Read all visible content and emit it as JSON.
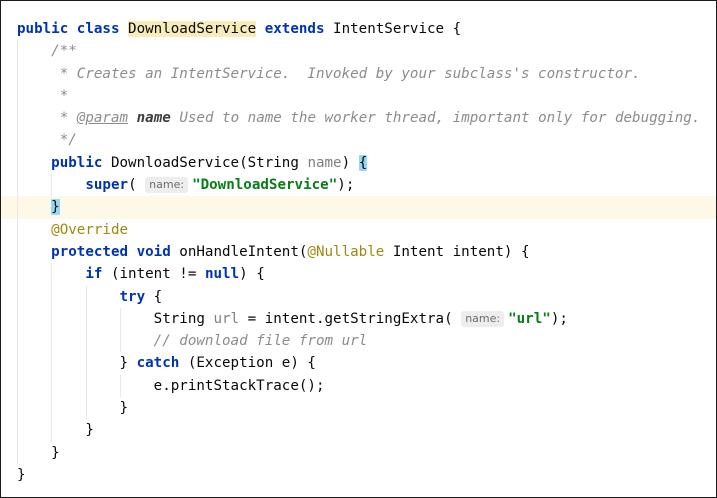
{
  "editor": {
    "lines": {
      "l1": {
        "kw1": "public class ",
        "cls": "DownloadService",
        "kw2": " extends ",
        "rest": "IntentService {"
      },
      "l2": {
        "indent": "    ",
        "text": "/**"
      },
      "l3": {
        "indent": "     ",
        "text": "* Creates an IntentService.  Invoked by your subclass's constructor."
      },
      "l4": {
        "indent": "     ",
        "text": "*"
      },
      "l5": {
        "indent": "     ",
        "star": "* ",
        "tag": "@param",
        "sp": " ",
        "pname": "name",
        "text": " Used to name the worker thread, important only for debugging."
      },
      "l6": {
        "indent": "     ",
        "text": "*/"
      },
      "l7": {
        "indent": "    ",
        "kw": "public ",
        "sig": "DownloadService(String ",
        "param": "name",
        "close": ") ",
        "brace": "{"
      },
      "l8": {
        "indent": "        ",
        "kw": "super",
        "open": "( ",
        "hint": "name:",
        "str": "\"DownloadService\"",
        "close": ");"
      },
      "l9": {
        "indent": "    ",
        "brace": "}"
      },
      "l10": {
        "indent": "    ",
        "ann": "@Override"
      },
      "l11": {
        "indent": "    ",
        "kw": "protected void ",
        "name": "onHandleIntent(",
        "ann": "@Nullable",
        "rest": " Intent intent) {"
      },
      "l12": {
        "indent": "        ",
        "kw1": "if",
        "mid": " (intent != ",
        "kw2": "null",
        "rest": ") {"
      },
      "l13": {
        "indent": "            ",
        "kw": "try",
        "rest": " {"
      },
      "l14": {
        "indent": "                ",
        "pre": "String ",
        "var": "url",
        "mid": " = intent.getStringExtra( ",
        "hint": "name:",
        "str": "\"url\"",
        "close": ");"
      },
      "l15": {
        "indent": "                ",
        "text": "// download file from url"
      },
      "l16": {
        "indent": "            ",
        "pre": "} ",
        "kw": "catch",
        "rest": " (Exception e) {"
      },
      "l17": {
        "indent": "                ",
        "text": "e.printStackTrace();"
      },
      "l18": {
        "indent": "            ",
        "text": "}"
      },
      "l19": {
        "indent": "        ",
        "text": "}"
      },
      "l20": {
        "indent": "    ",
        "text": "}"
      },
      "l21": {
        "text": "}"
      }
    }
  },
  "colors": {
    "keyword": "#0033b3",
    "string": "#067d17",
    "comment": "#8c8c8c",
    "annotation": "#9e880d",
    "class_highlight": "#f8ecb8",
    "current_line": "#fdf9e6",
    "brace_match": "#93d9f5"
  }
}
